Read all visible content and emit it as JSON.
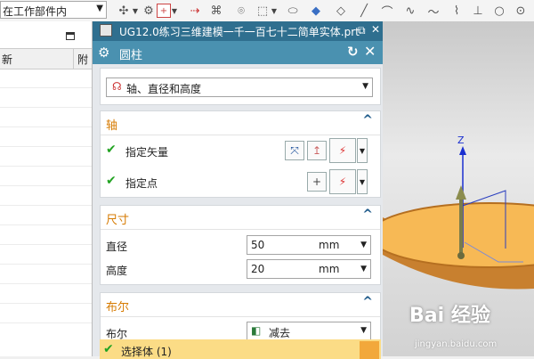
{
  "toolbar": {
    "scope_value": "在工作部件内",
    "dropdown_arrow": "▼"
  },
  "left_panel": {
    "header": {
      "col1": "新",
      "col2": "附"
    }
  },
  "dialog": {
    "window_title": "UG12.0练习三维建模一千一百七十二简单实体.prt",
    "title": "圆柱",
    "type_select": "轴、直径和高度",
    "sections": {
      "axis": {
        "title": "轴",
        "vector_label": "指定矢量",
        "point_label": "指定点"
      },
      "dimensions": {
        "title": "尺寸",
        "diameter_label": "直径",
        "diameter_value": "50",
        "diameter_unit": "mm",
        "height_label": "高度",
        "height_value": "20",
        "height_unit": "mm"
      },
      "boolean": {
        "title": "布尔",
        "label": "布尔",
        "value": "减去",
        "select_body": "选择体 (1)"
      }
    }
  },
  "viewport": {
    "axis_label": "Z",
    "watermark_brand": "Bai 经验",
    "watermark_url": "jingyan.baidu.com"
  },
  "colors": {
    "accent_title_bar": "#2f6f8f",
    "header_bar": "#4a91b0",
    "section_title": "#d67a00",
    "cylinder_top": "#f7b955",
    "cylinder_side": "#c8802f",
    "check": "#22a322",
    "highlight_row": "#fbdc86"
  }
}
